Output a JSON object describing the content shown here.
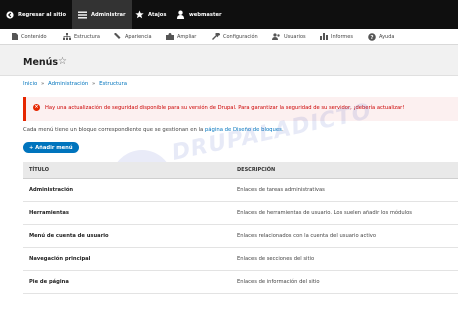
{
  "toolbar": {
    "back": "Regresar al sitio",
    "manage": "Administrar",
    "shortcuts": "Atajos",
    "user": "webmaster"
  },
  "admin_menu": [
    {
      "label": "Contenido",
      "icon": "document-icon"
    },
    {
      "label": "Estructura",
      "icon": "structure-icon"
    },
    {
      "label": "Apariencia",
      "icon": "paintbrush-icon"
    },
    {
      "label": "Ampliar",
      "icon": "puzzle-icon"
    },
    {
      "label": "Configuración",
      "icon": "wrench-icon"
    },
    {
      "label": "Usuarios",
      "icon": "people-icon"
    },
    {
      "label": "Informes",
      "icon": "bar-chart-icon"
    },
    {
      "label": "Ayuda",
      "icon": "help-icon"
    }
  ],
  "page": {
    "title": "Menús"
  },
  "breadcrumb": {
    "items": [
      "Inicio",
      "Administración",
      "Estructura"
    ],
    "separator": "»"
  },
  "alert": {
    "text": "Hay una actualización de seguridad disponible para su versión de Drupal. Para garantizar la seguridad de su servidor, ¡debería actualizar!"
  },
  "description": {
    "before": "Cada menú tiene un bloque correspondiente que se gestionan en la ",
    "link": "página de Diseño de bloques",
    "after": "."
  },
  "add_button": {
    "label": "+ Añadir menú"
  },
  "table": {
    "headers": [
      "TÍTULO",
      "DESCRIPCIÓN"
    ],
    "rows": [
      {
        "title": "Administración",
        "description": "Enlaces de tareas administrativas"
      },
      {
        "title": "Herramientas",
        "description": "Enlaces de herramientas de usuario. Los suelen añadir los módulos"
      },
      {
        "title": "Menú de cuenta de usuario",
        "description": "Enlaces relacionados con la cuenta del usuario activo"
      },
      {
        "title": "Navegación principal",
        "description": "Enlaces de secciones del sitio"
      },
      {
        "title": "Pie de página",
        "description": "Enlaces de información del sitio"
      }
    ]
  },
  "watermark": {
    "text": "DRUPALADICTO"
  },
  "colors": {
    "toolbar_bg": "#0f0f0f",
    "link": "#0074bd",
    "error": "#e62600",
    "alert_bg": "#fcf0f0"
  }
}
